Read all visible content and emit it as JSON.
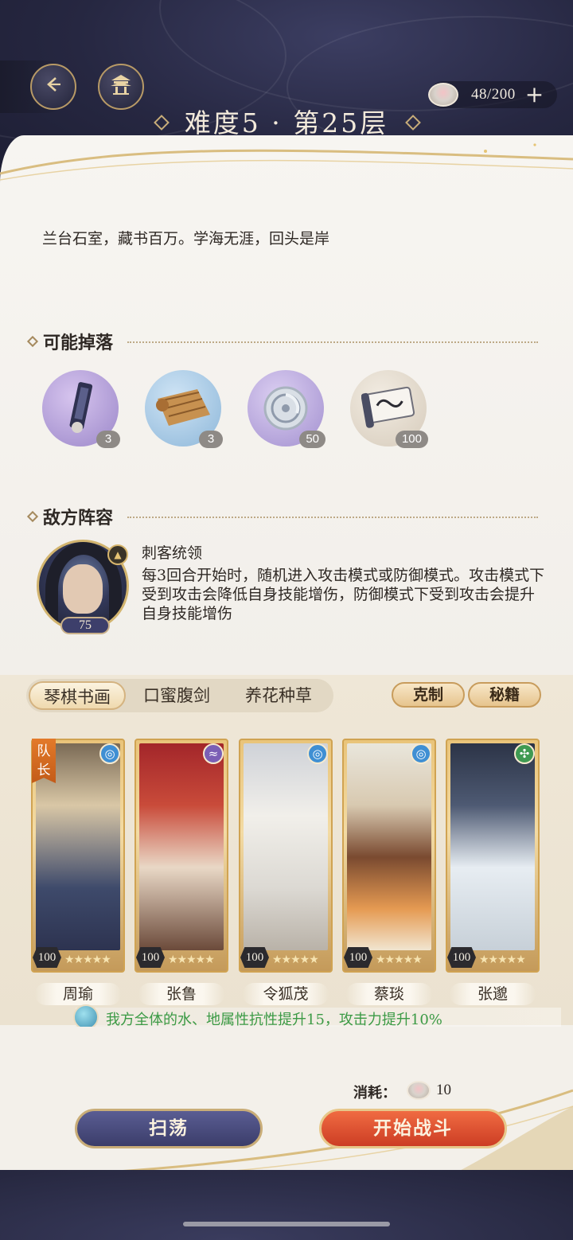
{
  "header": {
    "title": "难度5 · 第25层",
    "stamina": "48/200",
    "stamina_plus": "+"
  },
  "description": "兰台石室，藏书百万。学海无涯，回头是岸",
  "drops": {
    "title": "可能掉落",
    "items": [
      {
        "icon": "scroll-tag-icon",
        "count": "3"
      },
      {
        "icon": "bamboo-slips-icon",
        "count": "3"
      },
      {
        "icon": "silver-coin-icon",
        "count": "50"
      },
      {
        "icon": "embroidery-scroll-icon",
        "count": "100"
      }
    ]
  },
  "enemy": {
    "title": "敌方阵容",
    "name": "刺客统领",
    "level": "75",
    "skill": "每3回合开始时，随机进入攻击模式或防御模式。攻击模式下受到攻击会降低自身技能增伤，防御模式下受到攻击会提升自身技能增伤"
  },
  "team": {
    "tabs": [
      "琴棋书画",
      "口蜜腹剑",
      "养花种草"
    ],
    "restrain_label": "克制",
    "secret_label": "秘籍",
    "captain_label": "队长",
    "members": [
      {
        "name": "周瑜",
        "level": "100",
        "stars": "★★★★★",
        "element": "water",
        "elem_color": "#3f8fd3"
      },
      {
        "name": "张鲁",
        "level": "100",
        "stars": "★★★★★",
        "element": "cloud",
        "elem_color": "#7b5fb5"
      },
      {
        "name": "令狐茂",
        "level": "100",
        "stars": "★★★★★",
        "element": "water",
        "elem_color": "#3f8fd3"
      },
      {
        "name": "蔡琰",
        "level": "100",
        "stars": "★★★★★",
        "element": "water",
        "elem_color": "#3f8fd3"
      },
      {
        "name": "张邈",
        "level": "100",
        "stars": "★★★★★",
        "element": "wind",
        "elem_color": "#3f9a52"
      }
    ],
    "bonus": "我方全体的水、地属性抗性提升15，攻击力提升10%"
  },
  "footer": {
    "cost_label": "消耗：",
    "cost_value": "10",
    "sweep_label": "扫荡",
    "battle_label": "开始战斗"
  }
}
